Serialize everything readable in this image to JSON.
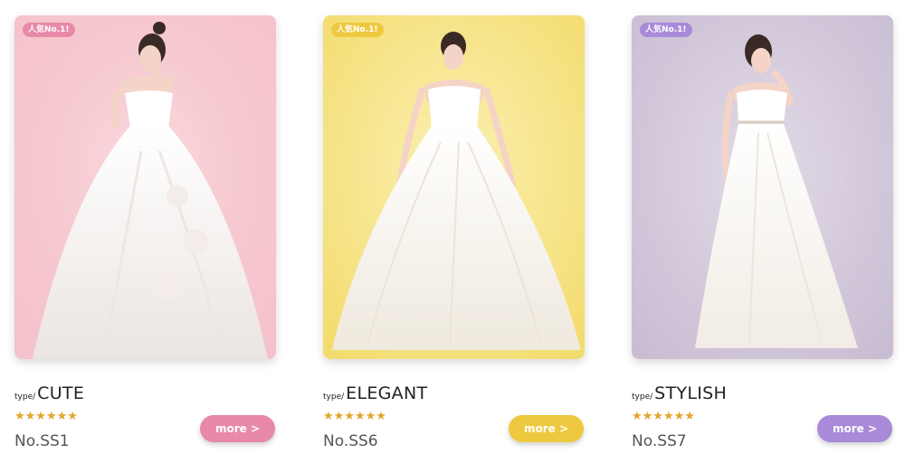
{
  "cards": [
    {
      "badge": "人気No.1!",
      "type_prefix": "type/",
      "type_name": "CUTE",
      "stars": "★★★★★★",
      "model_no": "No.SS1",
      "more_label": "more >",
      "photo": "woman-in-ballgown-wedding-dress",
      "accent_color": "#e889a8",
      "bg_color": "#f6c7cf"
    },
    {
      "badge": "人気No.1!",
      "type_prefix": "type/",
      "type_name": "ELEGANT",
      "stars": "★★★★★★",
      "model_no": "No.SS6",
      "more_label": "more >",
      "photo": "woman-in-aline-wedding-dress",
      "accent_color": "#eec93f",
      "bg_color": "#f7e58c"
    },
    {
      "badge": "人気No.1!",
      "type_prefix": "type/",
      "type_name": "STYLISH",
      "stars": "★★★★★★",
      "model_no": "No.SS7",
      "more_label": "more >",
      "photo": "woman-in-empire-wedding-dress",
      "accent_color": "#a98ad8",
      "bg_color": "#d4c9dd"
    }
  ]
}
